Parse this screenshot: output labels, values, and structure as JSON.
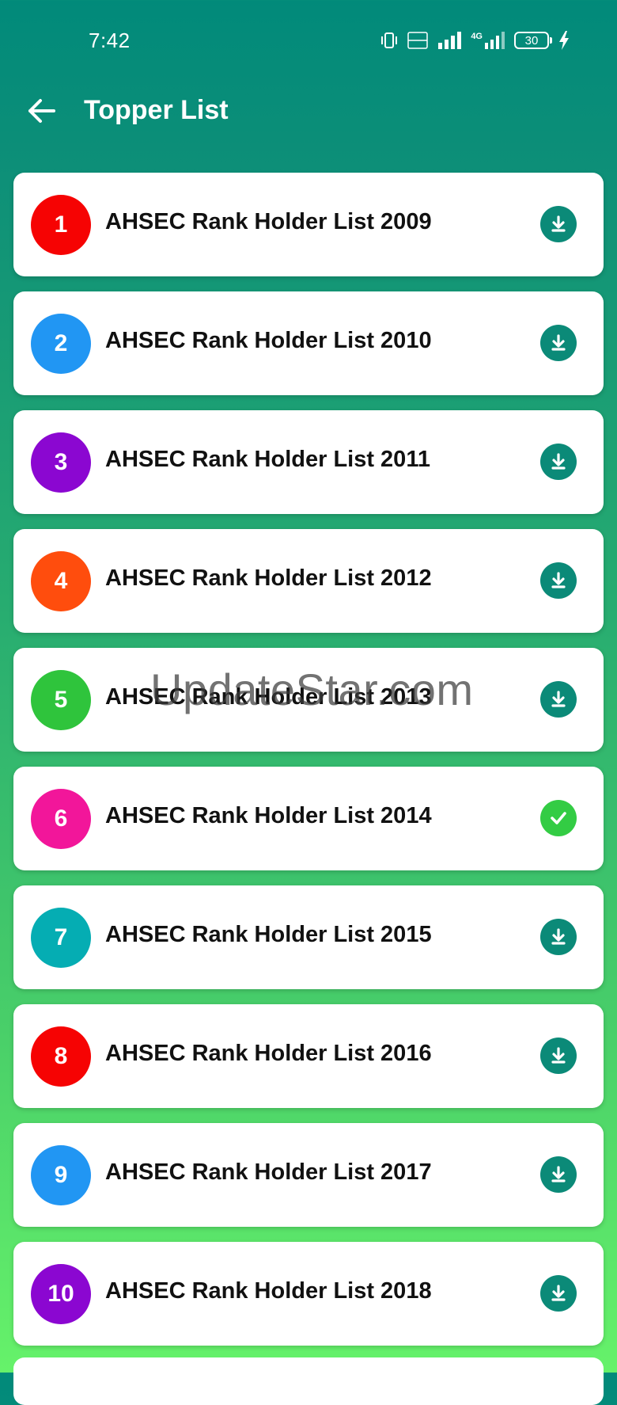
{
  "status_bar": {
    "time": "7:42",
    "battery": "30",
    "network_label": "4G"
  },
  "app_bar": {
    "title": "Topper List"
  },
  "colors": {
    "header": "#018a7a",
    "download_button": "#0b8a78",
    "done_button": "#33cc44"
  },
  "items": [
    {
      "rank": "1",
      "title": "AHSEC Rank Holder List 2009",
      "badge_color": "#f60303",
      "status": "download"
    },
    {
      "rank": "2",
      "title": "AHSEC Rank Holder List 2010",
      "badge_color": "#2196f3",
      "status": "download"
    },
    {
      "rank": "3",
      "title": "AHSEC Rank Holder List 2011",
      "badge_color": "#8b07d1",
      "status": "download"
    },
    {
      "rank": "4",
      "title": "AHSEC Rank Holder List 2012",
      "badge_color": "#ff4d0d",
      "status": "download"
    },
    {
      "rank": "5",
      "title": "AHSEC Rank Holder List 2013",
      "badge_color": "#2fc43c",
      "status": "download"
    },
    {
      "rank": "6",
      "title": "AHSEC Rank Holder List 2014",
      "badge_color": "#f2169a",
      "status": "downloaded"
    },
    {
      "rank": "7",
      "title": "AHSEC Rank Holder List 2015",
      "badge_color": "#05adb3",
      "status": "download"
    },
    {
      "rank": "8",
      "title": "AHSEC Rank Holder List 2016",
      "badge_color": "#f60303",
      "status": "download"
    },
    {
      "rank": "9",
      "title": "AHSEC Rank Holder List 2017",
      "badge_color": "#2196f3",
      "status": "download"
    },
    {
      "rank": "10",
      "title": "AHSEC Rank Holder List 2018",
      "badge_color": "#8b07d1",
      "status": "download"
    }
  ],
  "watermark": "UpdateStar.com"
}
